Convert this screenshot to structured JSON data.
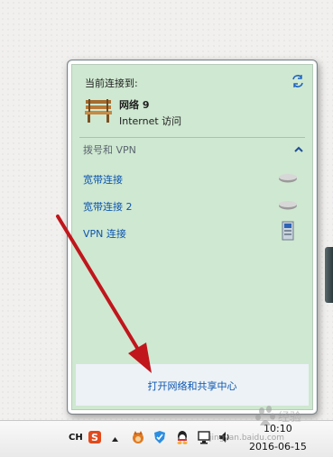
{
  "popup": {
    "header_label": "当前连接到:",
    "network": {
      "name": "网络  9",
      "access": "Internet 访问"
    },
    "section": {
      "title": "拨号和 VPN"
    },
    "connections": [
      {
        "label": "宽带连接",
        "icon": "drive-icon"
      },
      {
        "label": "宽带连接 2",
        "icon": "drive-icon"
      },
      {
        "label": "VPN 连接",
        "icon": "vpn-icon"
      }
    ],
    "footer_link": "打开网络和共享中心"
  },
  "taskbar": {
    "language": "CH",
    "time": "10:10",
    "date": "2016-06-15",
    "icons": [
      "sogou-icon",
      "chevron-up-icon",
      "fox-icon",
      "shield-icon",
      "qq-icon",
      "network-icon",
      "volume-icon"
    ]
  },
  "watermark": {
    "url": "jingyan.baidu.com",
    "brand": "Baidu 经验"
  },
  "colors": {
    "panel_bg": "#cfe8d1",
    "link": "#0b55b0",
    "arrow": "#c0161c"
  }
}
